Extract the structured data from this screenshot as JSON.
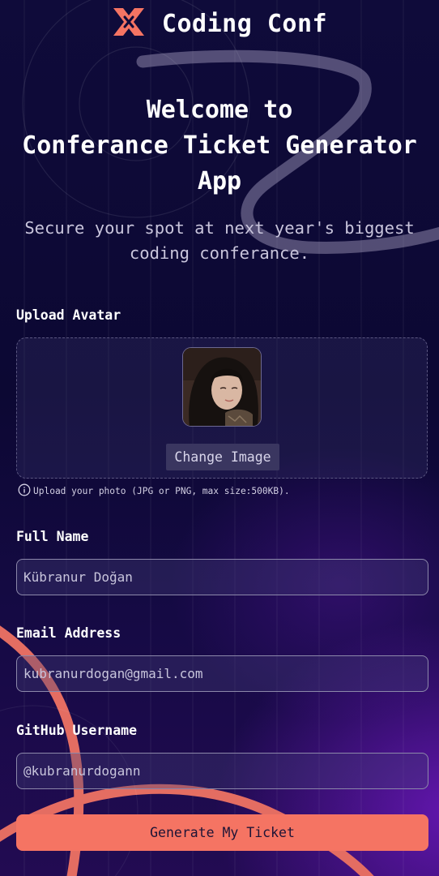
{
  "header": {
    "logo_text": "Coding Conf",
    "logo_icon": "coding-conf-logo-icon"
  },
  "hero": {
    "title_line1": "Welcome to",
    "title_line2": "Conferance Ticket Generator",
    "title_line3": "App",
    "subtitle_line1": "Secure your spot at next year's biggest",
    "subtitle_line2": "coding conferance."
  },
  "form": {
    "avatar": {
      "label": "Upload Avatar",
      "change_button": "Change Image",
      "hint": "Upload your photo (JPG or PNG, max size:500KB).",
      "hint_icon": "info-icon"
    },
    "full_name": {
      "label": "Full Name",
      "value": "Kübranur Doğan"
    },
    "email": {
      "label": "Email Address",
      "value": "kubranurdogan@gmail.com"
    },
    "github": {
      "label": "GitHub Username",
      "value": "@kubranurdogann"
    },
    "submit_label": "Generate My Ticket"
  },
  "colors": {
    "accent": "#f57463",
    "background": "#0d0835",
    "text": "#ffffff"
  }
}
